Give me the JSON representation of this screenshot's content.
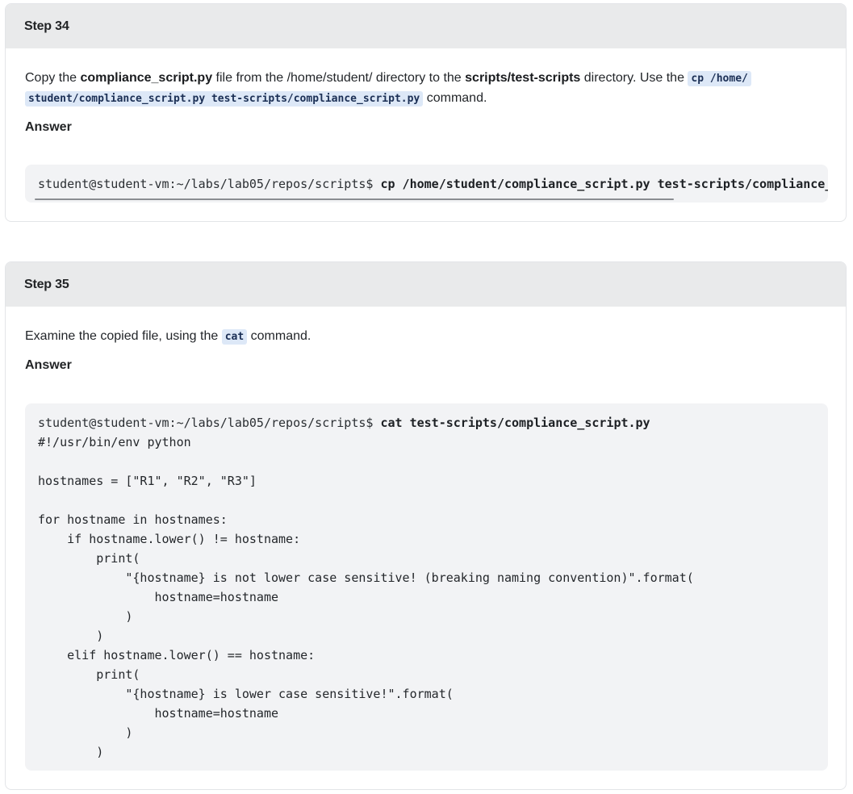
{
  "step34": {
    "title": "Step 34",
    "instruction": {
      "t1": "Copy the ",
      "b1": "compliance_script.py",
      "t2": " file from the /home/student/ directory to the ",
      "b2": "scripts/test-scripts",
      "t3": " directory. Use the ",
      "code_line1": "cp /home/",
      "code_line2": "student/compliance_script.py test-scripts/compliance_script.py",
      "t4": " command."
    },
    "answer_label": "Answer",
    "terminal": {
      "prompt": "student@student-vm:~/labs/lab05/repos/scripts$ ",
      "command": "cp /home/student/compliance_script.py test-scripts/compliance_script.py"
    }
  },
  "step35": {
    "title": "Step 35",
    "instruction": {
      "t1": "Examine the copied file, using the ",
      "code": "cat",
      "t2": " command."
    },
    "answer_label": "Answer",
    "terminal": {
      "prompt": "student@student-vm:~/labs/lab05/repos/scripts$ ",
      "command": "cat test-scripts/compliance_script.py",
      "output": "#!/usr/bin/env python\n\nhostnames = [\"R1\", \"R2\", \"R3\"]\n\nfor hostname in hostnames:\n    if hostname.lower() != hostname:\n        print(\n            \"{hostname} is not lower case sensitive! (breaking naming convention)\".format(\n                hostname=hostname\n            )\n        )\n    elif hostname.lower() == hostname:\n        print(\n            \"{hostname} is lower case sensitive!\".format(\n                hostname=hostname\n            )\n        )"
    }
  }
}
